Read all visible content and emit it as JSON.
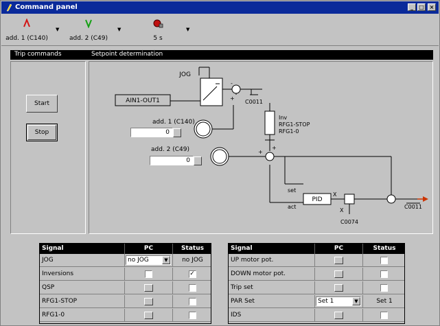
{
  "window": {
    "title": "Command panel"
  },
  "toolbar": {
    "items": [
      {
        "label": "add. 1 (C140)",
        "icon": "signal-red-icon"
      },
      {
        "label": "add. 2 (C49)",
        "icon": "signal-green-icon"
      },
      {
        "label": "5 s",
        "icon": "timer-icon"
      }
    ]
  },
  "tabs": [
    "Trip commands",
    "Setpoint determination"
  ],
  "commands": {
    "start_label": "Start",
    "stop_label": "Stop"
  },
  "diagram": {
    "jog_label": "JOG",
    "ain_label": "AIN1-OUT1",
    "add1_label": "add. 1 (C140)",
    "add1_value": "0",
    "add2_label": "add. 2 (C49)",
    "add2_value": "0",
    "c0011_top": "C0011",
    "rfg_labels": [
      "Inv",
      "RFG1-STOP",
      "RFG1-0"
    ],
    "pid_label": "PID",
    "set_label": "set",
    "act_label": "act",
    "x_label": "X",
    "c0074": "C0074",
    "c0011_out": "C0011",
    "plus": "+",
    "minus": "-"
  },
  "table_left": {
    "headers": [
      "Signal",
      "PC",
      "Status"
    ],
    "rows": [
      {
        "signal": "JOG",
        "pc": "no JOG",
        "pc_type": "dropdown",
        "status": "no JOG",
        "status_type": "text"
      },
      {
        "signal": "Inversions",
        "pc_type": "checkbox",
        "pc_checked": false,
        "status_type": "checkbox",
        "status_checked": true
      },
      {
        "signal": "QSP",
        "pc_type": "button",
        "status_type": "checkbox",
        "status_checked": false
      },
      {
        "signal": "RFG1-STOP",
        "pc_type": "button",
        "status_type": "checkbox",
        "status_checked": false
      },
      {
        "signal": "RFG1-0",
        "pc_type": "button",
        "status_type": "checkbox",
        "status_checked": false
      }
    ]
  },
  "table_right": {
    "headers": [
      "Signal",
      "PC",
      "Status"
    ],
    "rows": [
      {
        "signal": "UP motor pot.",
        "pc_type": "button",
        "status_type": "checkbox",
        "status_checked": false
      },
      {
        "signal": "DOWN motor pot.",
        "pc_type": "button",
        "status_type": "checkbox",
        "status_checked": false
      },
      {
        "signal": "Trip set",
        "pc_type": "button",
        "status_type": "checkbox",
        "status_checked": false
      },
      {
        "signal": "PAR Set",
        "pc": "Set 1",
        "pc_type": "dropdown",
        "status": "Set 1",
        "status_type": "text"
      },
      {
        "signal": "IDS",
        "pc_type": "button",
        "status_type": "checkbox",
        "status_checked": false
      }
    ]
  },
  "colors": {
    "title_bar": "#0a2a9a",
    "panel": "#c3c3c3",
    "wire": "#000000",
    "output_arrow": "#cc3300"
  }
}
